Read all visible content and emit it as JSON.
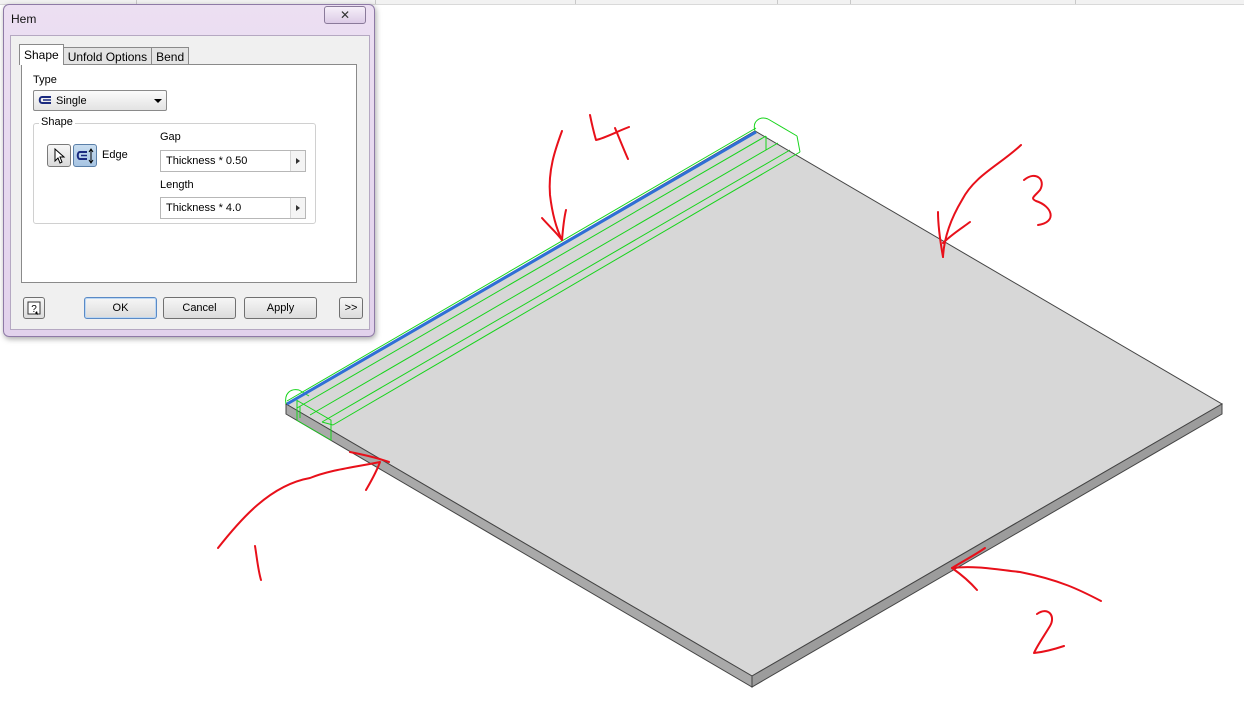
{
  "dialog": {
    "title": "Hem",
    "close_label": "✕",
    "tabs": [
      {
        "label": "Shape",
        "active": true
      },
      {
        "label": "Unfold Options",
        "active": false
      },
      {
        "label": "Bend",
        "active": false
      }
    ],
    "type_label": "Type",
    "type_value": "Single",
    "shape_group_label": "Shape",
    "edge_label": "Edge",
    "gap_label": "Gap",
    "gap_value": "Thickness * 0.50",
    "length_label": "Length",
    "length_value": "Thickness * 4.0",
    "buttons": {
      "ok": "OK",
      "cancel": "Cancel",
      "apply": "Apply",
      "more": ">>"
    },
    "help_icon": "help-icon"
  },
  "annotations": {
    "labels": [
      "1",
      "2",
      "3",
      "4"
    ],
    "color": "#e8101a"
  },
  "colors": {
    "plate_top": "#d7d7d7",
    "plate_side": "#a8a8a8",
    "preview_green": "#17d41b",
    "selected_edge": "#2f6fd6",
    "dialog_frame": "#e6d8ee"
  }
}
